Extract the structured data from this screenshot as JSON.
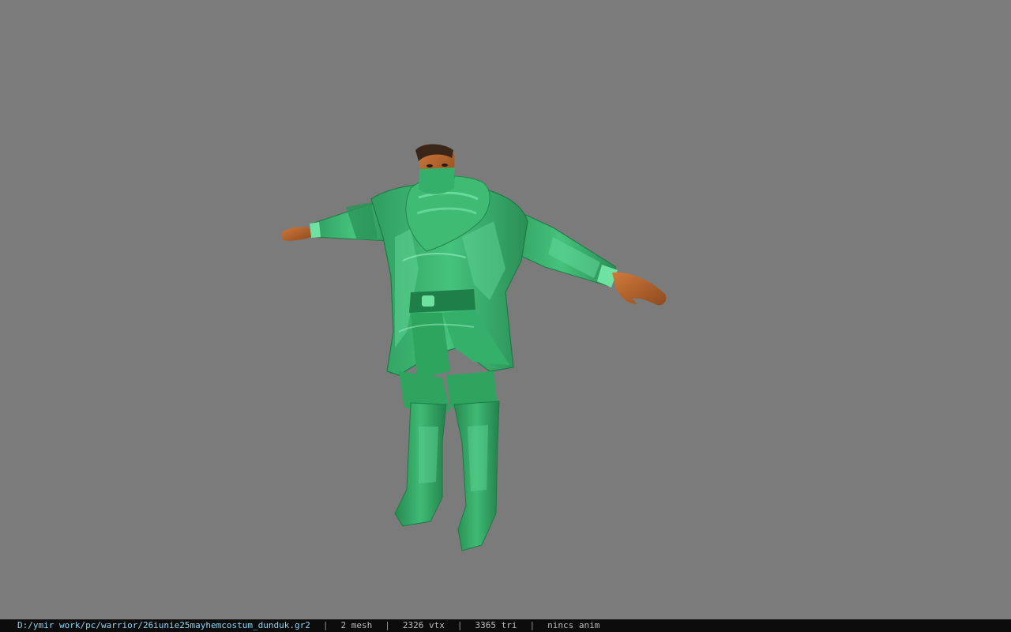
{
  "statusbar": {
    "file_path": "D:/ymir work/pc/warrior/26iunie25mayhemcostum_dunduk.gr2",
    "separator": "|",
    "mesh": "2 mesh",
    "vertices": "2326 vtx",
    "triangles": "3365 tri",
    "animation": "nincs anim"
  },
  "viewport": {
    "background_color": "#7b7b7b",
    "model": "warrior-costume-model"
  },
  "colors": {
    "costume_green": "#36b36a",
    "costume_dark": "#1e7a45",
    "costume_light": "#6fe2a1",
    "skin": "#b3622b",
    "hair": "#3a2618"
  }
}
